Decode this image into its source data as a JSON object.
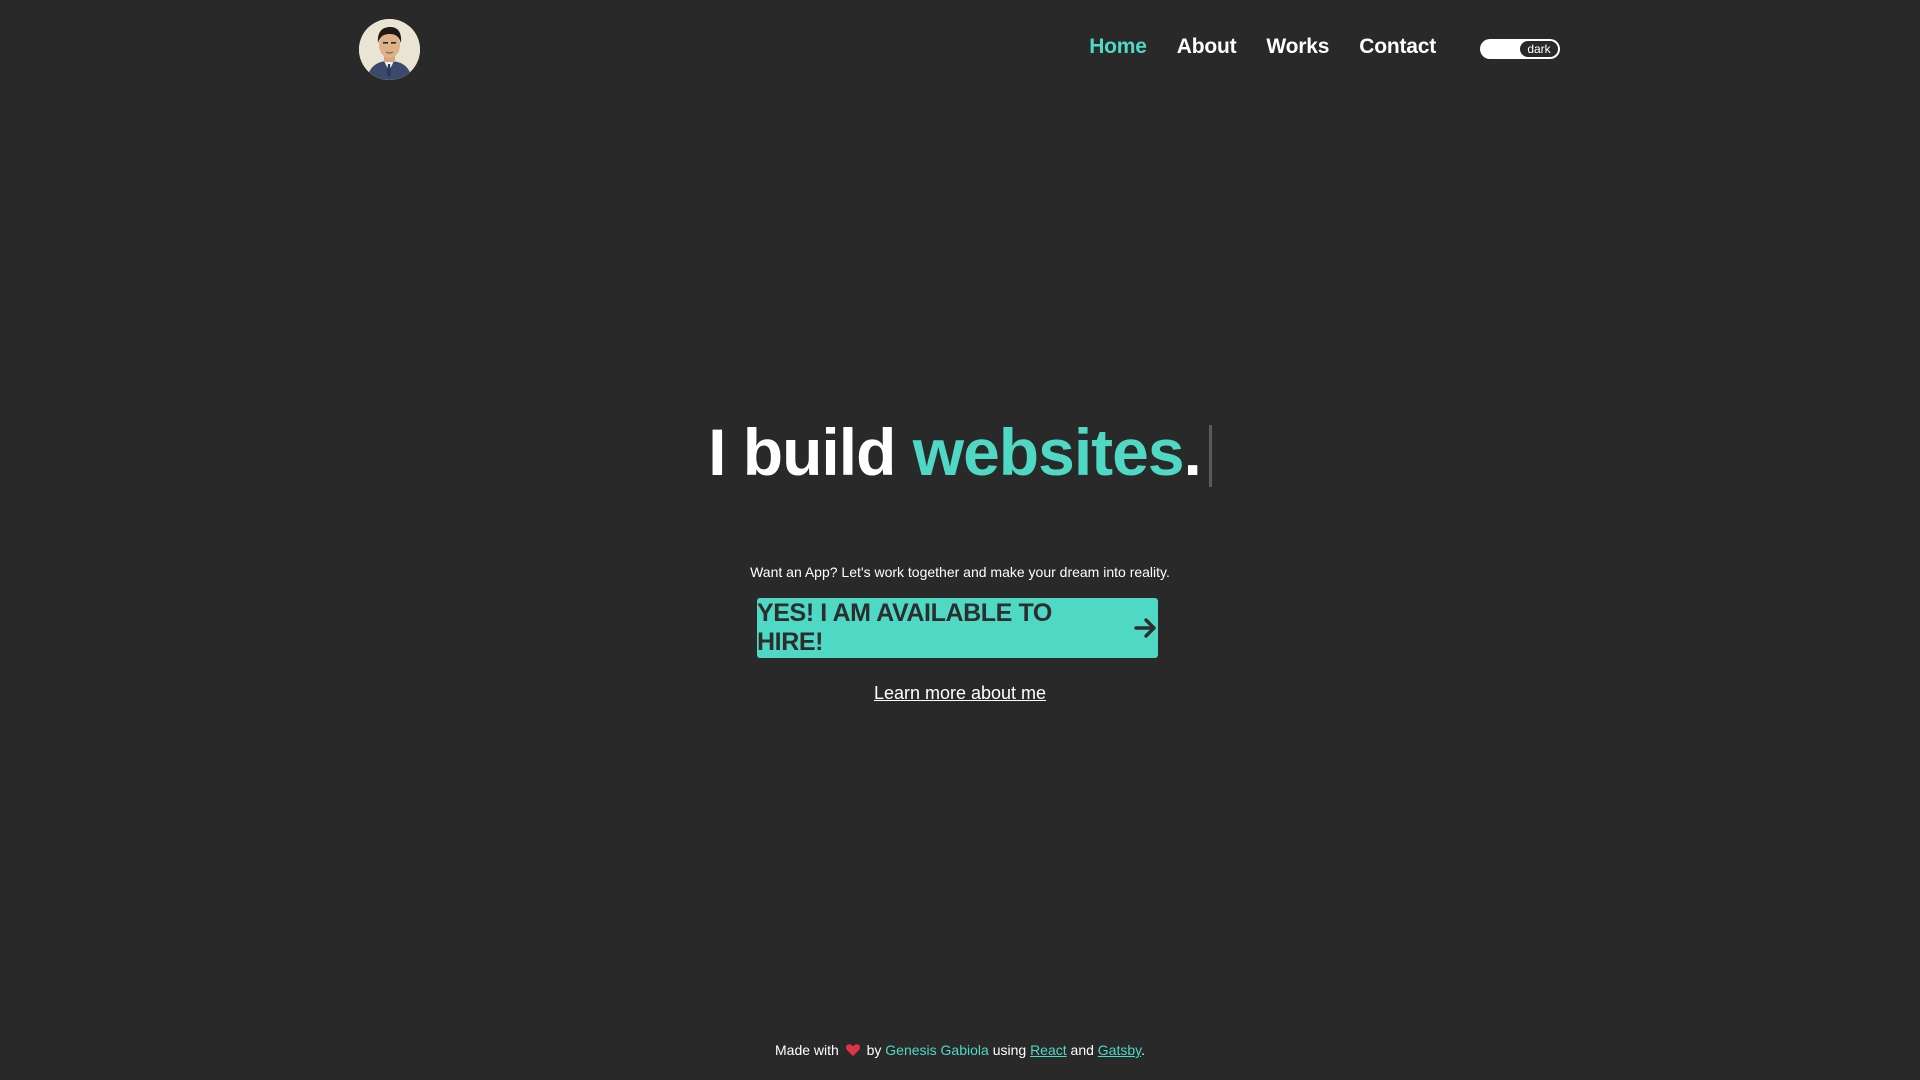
{
  "header": {
    "avatar_alt": "avatar",
    "nav": [
      {
        "label": "Home",
        "active": true
      },
      {
        "label": "About",
        "active": false
      },
      {
        "label": "Works",
        "active": false
      },
      {
        "label": "Contact",
        "active": false
      }
    ],
    "theme_toggle": {
      "label": "dark"
    }
  },
  "hero": {
    "title_prefix": "I build ",
    "title_accent": "websites",
    "title_suffix": ".",
    "tagline": "Want an App? Let's work together and make your dream into reality.",
    "cta_label": "YES! I AM AVAILABLE TO HIRE!",
    "cta_icon": "arrow-right-icon",
    "learn_more": "Learn more about me"
  },
  "footer": {
    "made_with": "Made with",
    "heart_icon": "heart-icon",
    "by": "by",
    "author": "Genesis Gabiola",
    "using": "using",
    "react": "React",
    "and": "and",
    "gatsby": "Gatsby",
    "period": "."
  },
  "colors": {
    "background": "#292929",
    "accent": "#4fd8c4",
    "heart": "#e0334a"
  }
}
